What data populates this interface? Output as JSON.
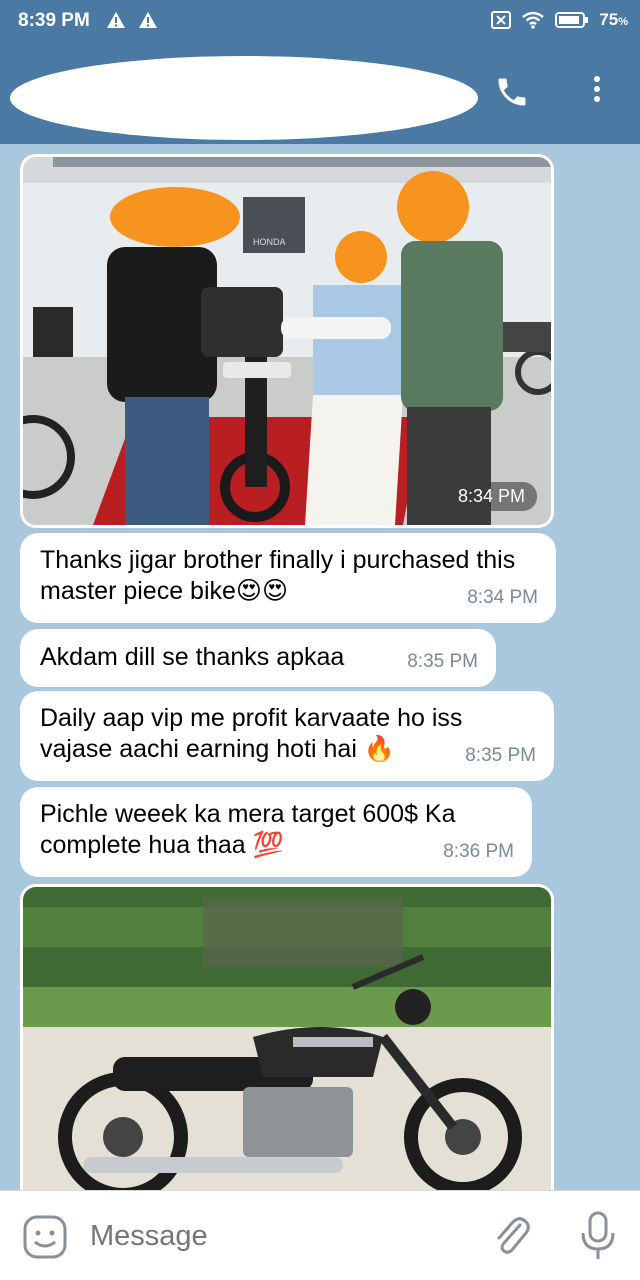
{
  "status_bar": {
    "time": "8:39 PM",
    "battery": "75",
    "battery_unit": "%"
  },
  "header": {
    "icons": [
      "phone-icon",
      "more-vert-icon"
    ]
  },
  "messages": [
    {
      "type": "photo",
      "time": "8:34 PM",
      "subject": "honda-bike-delivery-photo"
    },
    {
      "type": "text",
      "text": "Thanks jigar brother finally i purchased this master piece bike😍😍",
      "time": "8:34 PM"
    },
    {
      "type": "text",
      "text": "Akdam dill se thanks apkaa",
      "time": "8:35 PM"
    },
    {
      "type": "text",
      "text": "Daily aap vip me profit karvaate ho iss vajase aachi earning hoti hai 🔥",
      "time": "8:35 PM"
    },
    {
      "type": "text",
      "text": "Pichle weeek ka mera target 600$ Ka complete hua thaa 💯",
      "time": "8:36 PM"
    },
    {
      "type": "photo",
      "subject": "honda-motorcycle-photo"
    }
  ],
  "input": {
    "placeholder": "Message"
  },
  "colors": {
    "header": "#4a7aa4",
    "chat_bg": "#a9c8de",
    "bubble": "#ffffff",
    "time_text": "#7a8a96"
  }
}
